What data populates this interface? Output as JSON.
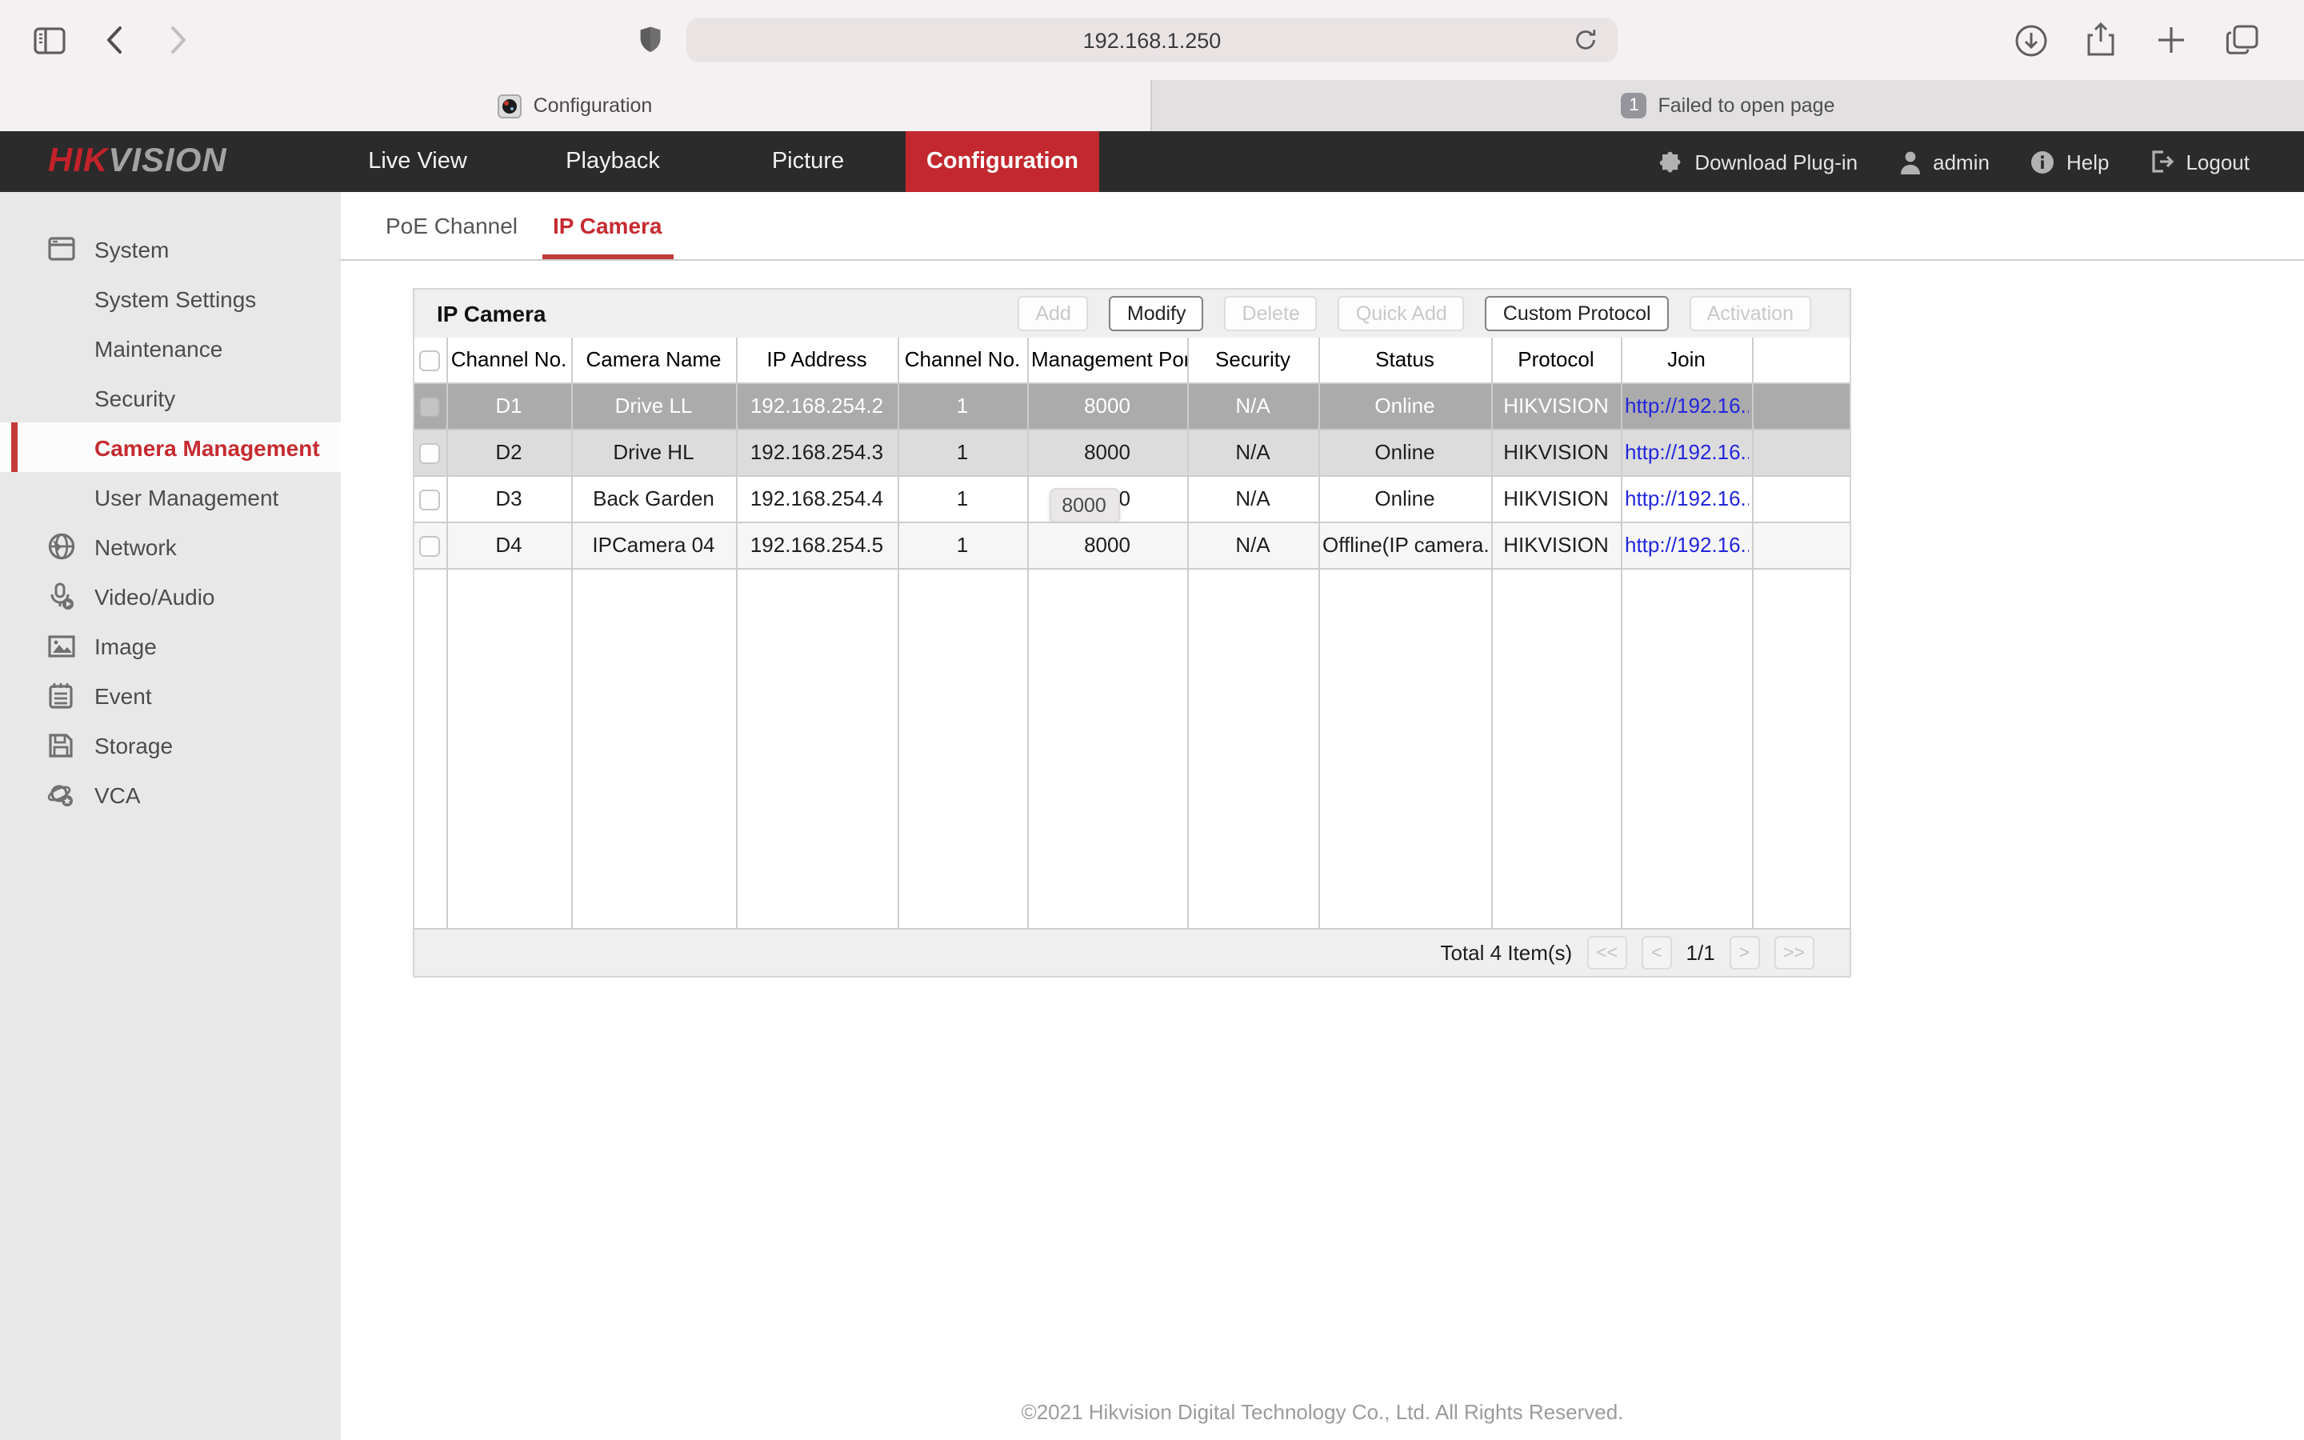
{
  "colors": {
    "accent_red": "#c2282d",
    "link_blue": "#2326dd",
    "selected_row": "#ababab",
    "header_dark": "#2b2b2b"
  },
  "browser": {
    "url": "192.168.1.250",
    "tabs": [
      {
        "title": "Configuration",
        "active": true
      },
      {
        "title": "Failed to open page",
        "badge": "1",
        "active": false
      }
    ]
  },
  "header": {
    "logo_part1": "HIK",
    "logo_part2": "VISION",
    "nav": [
      {
        "label": "Live View"
      },
      {
        "label": "Playback"
      },
      {
        "label": "Picture"
      },
      {
        "label": "Configuration",
        "active": true
      }
    ],
    "actions": [
      {
        "label": "Download Plug-in"
      },
      {
        "label": "admin"
      },
      {
        "label": "Help"
      },
      {
        "label": "Logout"
      }
    ]
  },
  "sidebar": {
    "items": [
      {
        "label": "System"
      },
      {
        "label": "System Settings"
      },
      {
        "label": "Maintenance"
      },
      {
        "label": "Security"
      },
      {
        "label": "Camera Management",
        "active": true
      },
      {
        "label": "User Management"
      },
      {
        "label": "Network"
      },
      {
        "label": "Video/Audio"
      },
      {
        "label": "Image"
      },
      {
        "label": "Event"
      },
      {
        "label": "Storage"
      },
      {
        "label": "VCA"
      }
    ]
  },
  "content": {
    "tabs": [
      {
        "label": "PoE Channel"
      },
      {
        "label": "IP Camera",
        "active": true
      }
    ],
    "panel": {
      "title": "IP Camera",
      "buttons": [
        {
          "label": "Add",
          "enabled": false
        },
        {
          "label": "Modify",
          "enabled": true
        },
        {
          "label": "Delete",
          "enabled": false
        },
        {
          "label": "Quick Add",
          "enabled": false
        },
        {
          "label": "Custom Protocol",
          "enabled": true
        },
        {
          "label": "Activation",
          "enabled": false
        }
      ],
      "table": {
        "columns": [
          "Channel No.",
          "Camera Name",
          "IP Address",
          "Channel No.",
          "Management Port",
          "Security",
          "Status",
          "Protocol",
          "Join"
        ],
        "rows": [
          {
            "channel_no": "D1",
            "camera_name": "Drive LL",
            "ip_address": "192.168.254.2",
            "channel_no2": "1",
            "management_port": "8000",
            "security": "N/A",
            "status": "Online",
            "protocol": "HIKVISION",
            "join": "http://192.16...",
            "selected": true
          },
          {
            "channel_no": "D2",
            "camera_name": "Drive HL",
            "ip_address": "192.168.254.3",
            "channel_no2": "1",
            "management_port": "8000",
            "security": "N/A",
            "status": "Online",
            "protocol": "HIKVISION",
            "join": "http://192.16...",
            "selected": false
          },
          {
            "channel_no": "D3",
            "camera_name": "Back Garden",
            "ip_address": "192.168.254.4",
            "channel_no2": "1",
            "management_port": "8000",
            "security": "N/A",
            "status": "Online",
            "protocol": "HIKVISION",
            "join": "http://192.16...",
            "selected": false
          },
          {
            "channel_no": "D4",
            "camera_name": "IPCamera 04",
            "ip_address": "192.168.254.5",
            "channel_no2": "1",
            "management_port": "8000",
            "security": "N/A",
            "status": "Offline(IP camera...",
            "protocol": "HIKVISION",
            "join": "http://192.16...",
            "selected": false
          }
        ]
      },
      "tooltip": "8000",
      "footer": {
        "total": "Total 4 Item(s)",
        "page": "1/1",
        "pagination": [
          "<<",
          "<",
          ">",
          ">>"
        ]
      }
    },
    "copyright": "©2021 Hikvision Digital Technology Co., Ltd. All Rights Reserved."
  }
}
